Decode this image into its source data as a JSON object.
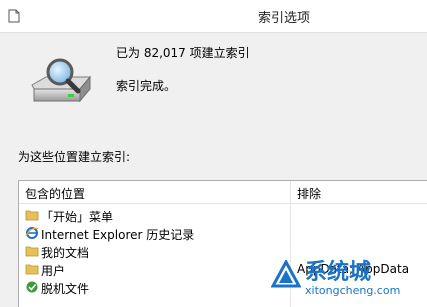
{
  "window": {
    "title": "索引选项"
  },
  "status": {
    "items_indexed": "已为 82,017 项建立索引",
    "indexing_state": "索引完成。"
  },
  "locations": {
    "label": "为这些位置建立索引:",
    "columns": {
      "included": "包含的位置",
      "excluded": "排除"
    },
    "rows": [
      {
        "name": "「开始」菜单",
        "icon": "folder-icon",
        "excluded": ""
      },
      {
        "name": "Internet Explorer 历史记录",
        "icon": "internet-explorer-icon",
        "excluded": ""
      },
      {
        "name": "我的文档",
        "icon": "folder-icon",
        "excluded": ""
      },
      {
        "name": "用户",
        "icon": "folder-icon",
        "excluded": "AppData; AppData"
      },
      {
        "name": "脱机文件",
        "icon": "offline-files-icon",
        "excluded": ""
      }
    ]
  },
  "watermark": {
    "title": "系统城",
    "url": "xitongcheng.com"
  },
  "colors": {
    "folder": "#e8c05a",
    "ie_blue": "#1f6fd1",
    "offline_green": "#3a9b3a",
    "watermark": "#1a73c7"
  }
}
